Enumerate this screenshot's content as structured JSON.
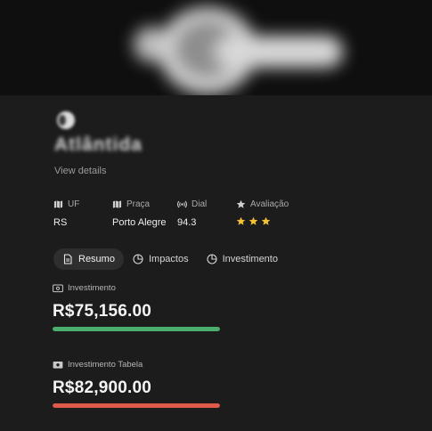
{
  "station": {
    "name": "Atlântida",
    "view_details": "View details"
  },
  "info": [
    {
      "label": "UF",
      "value": "RS",
      "icon": "map-icon"
    },
    {
      "label": "Praça",
      "value": "Porto Alegre",
      "icon": "map-icon"
    },
    {
      "label": "Dial",
      "value": "94.3",
      "icon": "radio-signal-icon"
    },
    {
      "label": "Avaliação",
      "value": "3 stars",
      "icon": "star-icon"
    }
  ],
  "rating": {
    "stars": 3,
    "color": "#f2c233"
  },
  "tabs": [
    {
      "label": "Resumo",
      "icon": "document-icon",
      "active": true
    },
    {
      "label": "Impactos",
      "icon": "pie-chart-icon",
      "active": false
    },
    {
      "label": "Investimento",
      "icon": "pie-chart-icon",
      "active": false
    }
  ],
  "metrics": [
    {
      "label": "Investimento",
      "value": "R$75,156.00",
      "bar_color": "#4caf6e",
      "progress": 1.0,
      "icon": "money-refresh-icon"
    },
    {
      "label": "Investimento Tabela",
      "value": "R$82,900.00",
      "bar_color": "#e05a4c",
      "progress": 1.0,
      "icon": "money-icon"
    }
  ],
  "colors": {
    "background": "#1c1c1c",
    "banner": "#0f0f0f",
    "active_tab": "#2e2e2e"
  }
}
